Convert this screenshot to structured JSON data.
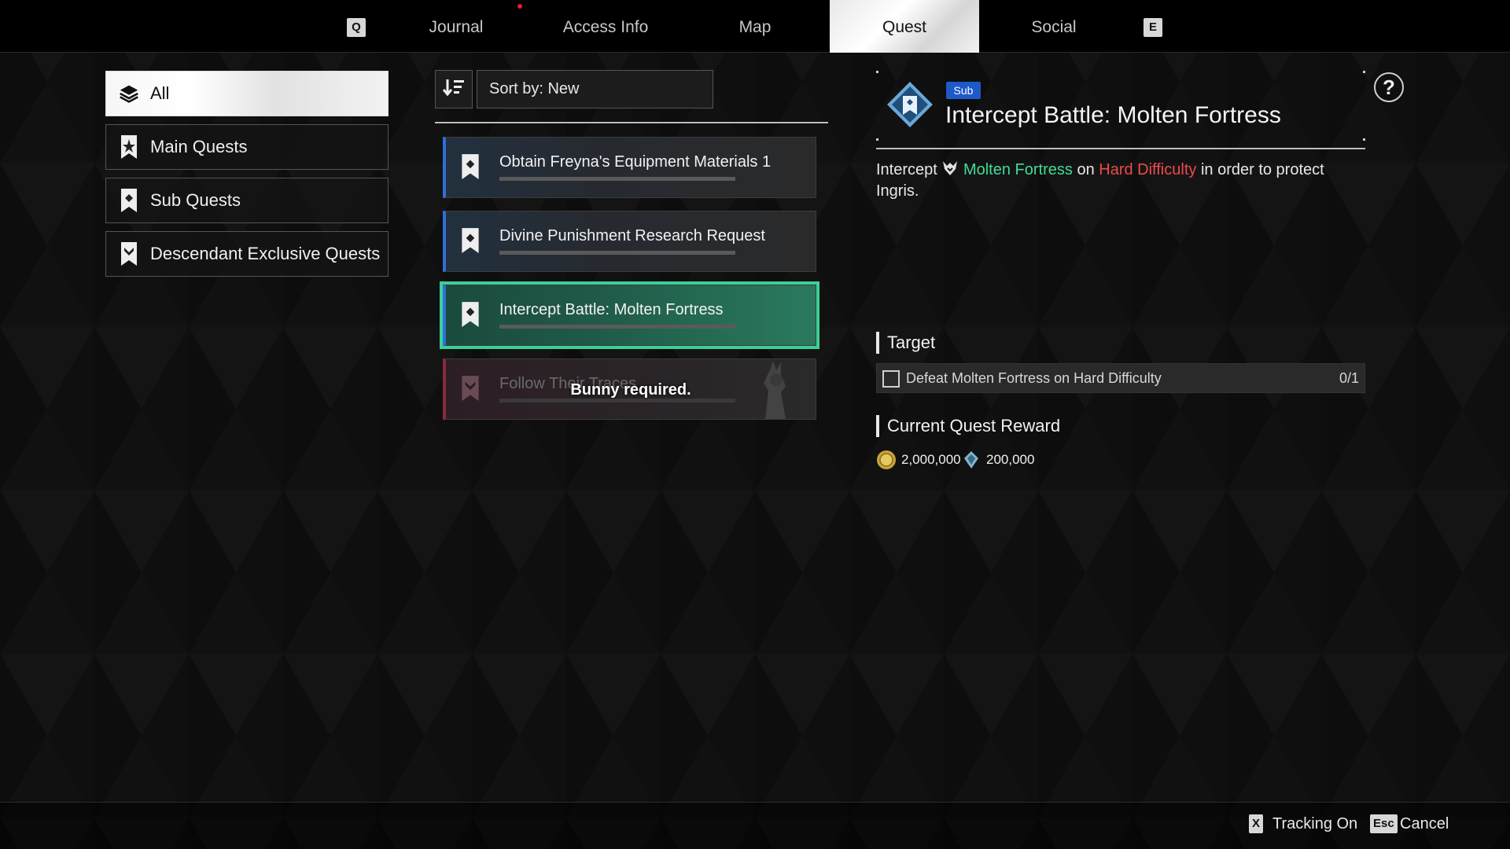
{
  "colors": {
    "accent_green": "#3ccf96",
    "quest_blue": "#2f6fd6",
    "sub_badge": "#1d59c9",
    "highlight_red": "#f04a4a",
    "highlight_green": "#3fdc95"
  },
  "topnav": {
    "left_key": "Q",
    "right_key": "E",
    "tabs": [
      "Journal",
      "Access Info",
      "Map",
      "Quest",
      "Social"
    ],
    "active_tab": "Quest"
  },
  "categories": [
    {
      "label": "All",
      "icon": "layers-icon",
      "active": true
    },
    {
      "label": "Main Quests",
      "icon": "main-quest-bookmark-icon"
    },
    {
      "label": "Sub Quests",
      "icon": "sub-quest-bookmark-icon"
    },
    {
      "label": "Descendant Exclusive Quests",
      "icon": "descendant-bookmark-icon"
    }
  ],
  "sort": {
    "label": "Sort by: New",
    "icon": "sort-descending-icon"
  },
  "quests": [
    {
      "name": "Obtain Freyna's Equipment Materials 1",
      "icon": "sub-quest-bookmark-icon"
    },
    {
      "name": "Divine Punishment Research Request",
      "icon": "sub-quest-bookmark-icon"
    },
    {
      "name": "Intercept Battle: Molten Fortress",
      "icon": "sub-quest-bookmark-icon",
      "selected": true
    },
    {
      "name": "Follow Their Traces",
      "icon": "descendant-bookmark-icon",
      "locked": true,
      "lock_message": "Bunny required."
    }
  ],
  "detail": {
    "badge": "Sub",
    "title": "Intercept Battle: Molten Fortress",
    "desc_prefix": "Intercept",
    "desc_boss": "Molten Fortress",
    "desc_on": "on",
    "desc_difficulty": "Hard Difficulty",
    "desc_suffix": "in order to protect Ingris.",
    "target_heading": "Target",
    "target_text": "Defeat Molten Fortress on Hard Difficulty",
    "target_progress": "0/1",
    "reward_heading": "Current Quest Reward",
    "rewards": [
      {
        "icon": "gold-coin-icon",
        "amount": "2,000,000"
      },
      {
        "icon": "kuiper-shard-icon",
        "amount": "200,000"
      }
    ],
    "help": "?"
  },
  "footer": {
    "track_key": "X",
    "track_label": "Tracking On",
    "cancel_key": "Esc",
    "cancel_label": "Cancel"
  }
}
